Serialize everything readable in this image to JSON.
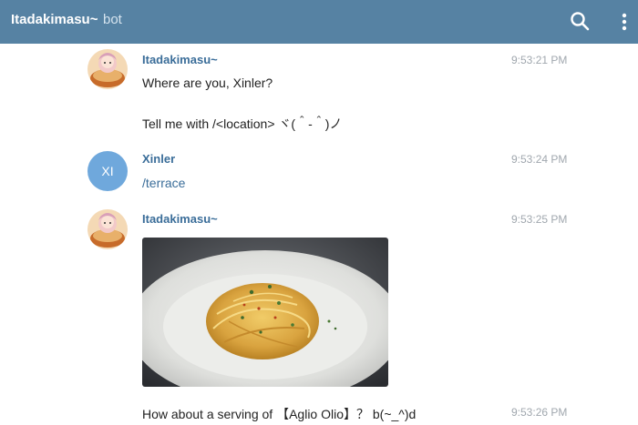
{
  "header": {
    "title": "Itadakimasu~",
    "subtitle": "bot"
  },
  "messages": [
    {
      "sender": "Itadakimasu~",
      "time": "9:53:21 PM",
      "lines": [
        "Where are you, Xinler?",
        "Tell me with /<location>  ヾ(＾-＾)ノ"
      ]
    },
    {
      "sender": "Xinler",
      "initials": "XI",
      "time": "9:53:24 PM",
      "text": "/terrace"
    },
    {
      "sender": "Itadakimasu~",
      "time": "9:53:25 PM",
      "caption": "How about a serving of 【Aglio Olio】？ b(~_^)d",
      "caption_time": "9:53:26 PM"
    }
  ],
  "colors": {
    "header": "#5682a3",
    "sender_name": "#3a6d99",
    "timestamp": "#a0a7ae",
    "user_avatar": "#6fa8dc"
  },
  "icons": {
    "search": "search-icon",
    "menu": "more-vertical-icon"
  }
}
